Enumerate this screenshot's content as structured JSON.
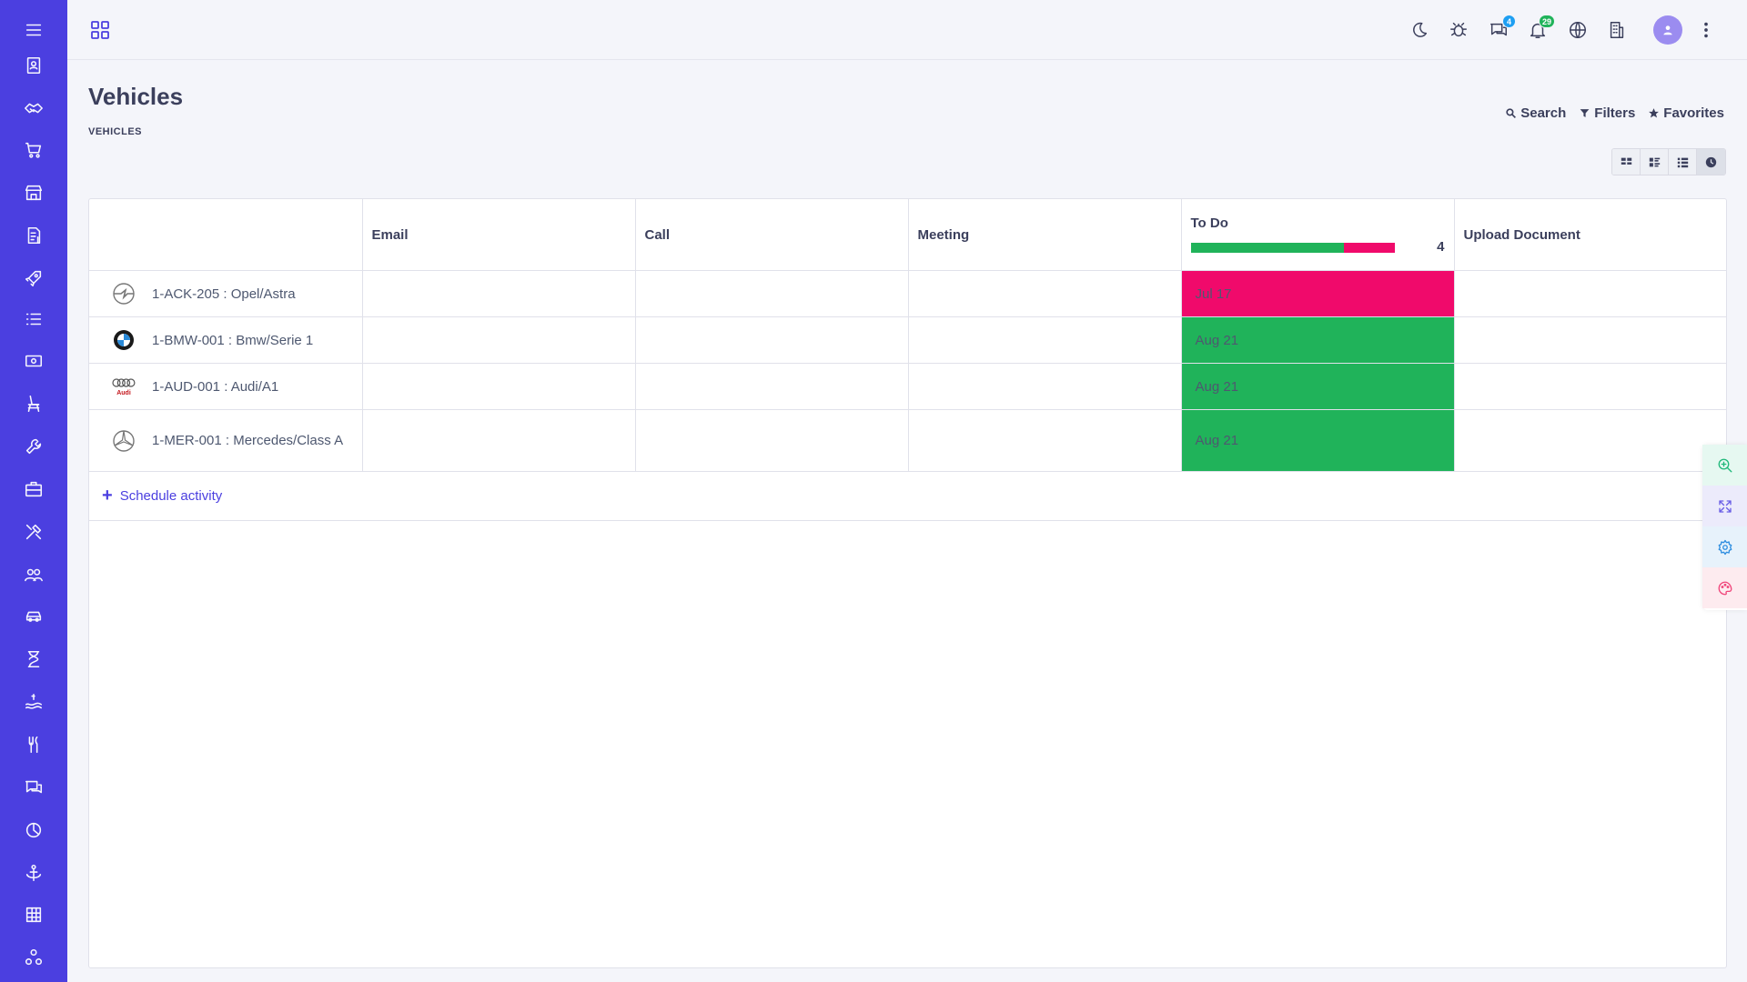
{
  "colors": {
    "sidebar": "#4b3fe0",
    "overdue": "#f00a6b",
    "planned": "#20b35a",
    "accent": "#4b3fe0"
  },
  "sidebar": {
    "items": [
      "menu-icon",
      "contacts-icon",
      "handshake-icon",
      "cart-icon",
      "store-icon",
      "invoice-icon",
      "rocket-icon",
      "tasks-icon",
      "money-icon",
      "chair-icon",
      "wrench-icon",
      "briefcase-icon",
      "tools-icon",
      "people-icon",
      "car-icon",
      "hourglass-icon",
      "salary-icon",
      "restaurant-icon",
      "chat-icon",
      "pie-chart-icon",
      "anchor-icon",
      "grid-icon",
      "apps-icon"
    ]
  },
  "topbar": {
    "icons": [
      "moon-icon",
      "bug-icon",
      "messages-icon",
      "bell-icon",
      "globe-icon",
      "building-icon"
    ],
    "messages_count": "4",
    "notifications_count": "29"
  },
  "page": {
    "title": "Vehicles",
    "breadcrumb": "VEHICLES"
  },
  "search_actions": {
    "search": "Search",
    "filters": "Filters",
    "favorites": "Favorites"
  },
  "columns": {
    "email": "Email",
    "call": "Call",
    "meeting": "Meeting",
    "todo": "To Do",
    "todo_count": "4",
    "todo_progress": {
      "planned": 0.75,
      "overdue": 0.25
    },
    "upload": "Upload Document"
  },
  "rows": [
    {
      "name": "1-ACK-205 : Opel/Astra",
      "logo": "opel-logo",
      "todo": "Jul 17",
      "status": "overdue"
    },
    {
      "name": "1-BMW-001 : Bmw/Serie 1",
      "logo": "bmw-logo",
      "todo": "Aug 21",
      "status": "planned"
    },
    {
      "name": "1-AUD-001 : Audi/A1",
      "logo": "audi-logo",
      "todo": "Aug 21",
      "status": "planned"
    },
    {
      "name": "1-MER-001 : Mercedes/Class A",
      "logo": "mercedes-logo",
      "todo": "Aug 21",
      "status": "planned"
    }
  ],
  "audi_wordmark": "Audi",
  "schedule_label": "Schedule activity"
}
